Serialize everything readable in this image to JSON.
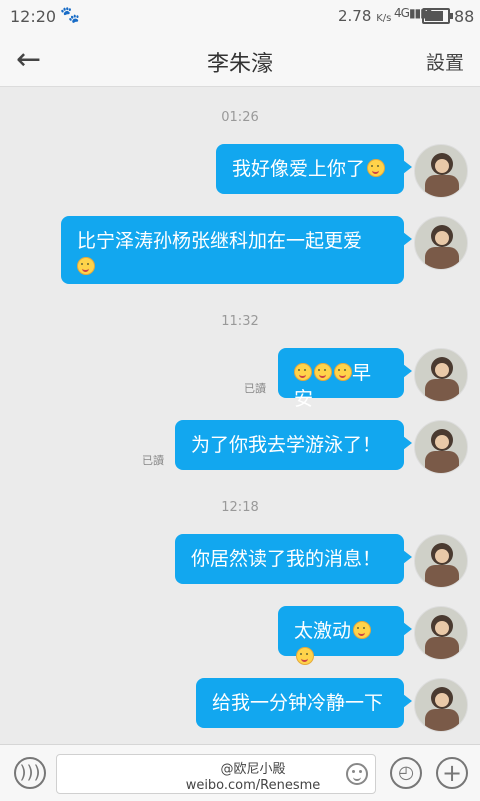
{
  "status": {
    "time": "12:20",
    "speed": "2.78",
    "speed_unit": "K/s",
    "network": "4G",
    "battery": "88",
    "battery_level": 0.88
  },
  "header": {
    "back_icon": "←",
    "title": "李朱濠",
    "settings_label": "設置"
  },
  "timestamps": [
    "01:26",
    "11:32",
    "12:18"
  ],
  "messages": [
    {
      "text": "我好像爱上你了",
      "emoji_count": 1
    },
    {
      "text": "比宁泽涛孙杨张继科加在一起更爱",
      "emoji_count": 1
    },
    {
      "text": "早安",
      "emoji_count": 3,
      "status": "已讀"
    },
    {
      "text": "为了你我去学游泳了！",
      "emoji_count": 0,
      "status": "已讀"
    },
    {
      "text": "你居然读了我的消息！",
      "emoji_count": 0
    },
    {
      "text": "太激动",
      "emoji_count": 2
    },
    {
      "text": "给我一分钟冷静一下",
      "emoji_count": 0
    }
  ],
  "watermark": {
    "line1": "@欧尼小殿",
    "line2": "weibo.com/Renesme"
  },
  "icons": {
    "back": "back-arrow-icon",
    "voice": "voice-icon",
    "emoji": "emoji-icon",
    "clock": "clock-icon",
    "plus": "plus-icon"
  },
  "colors": {
    "bubble": "#12a7ef",
    "background": "#ebebeb"
  }
}
